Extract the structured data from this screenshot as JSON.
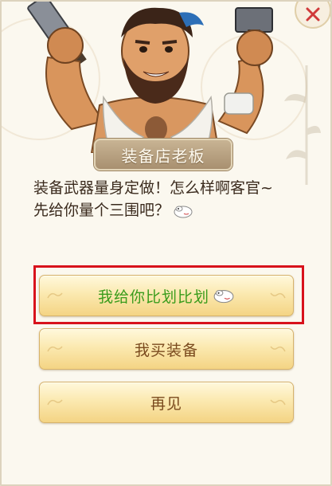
{
  "npc": {
    "name": "装备店老板",
    "portrait_icon": "blacksmith-npc-portrait"
  },
  "dialogue": {
    "line1": "装备武器量身定做！怎么样啊客官~",
    "line2": "先给你量个三围吧？",
    "emoji": "sheep-emoji-icon"
  },
  "options": [
    {
      "label": "我给你比划比划",
      "emoji": "sheep-emoji-icon",
      "selected": true
    },
    {
      "label": "我买装备"
    },
    {
      "label": "再见"
    }
  ],
  "colors": {
    "highlight_border": "#d8121c",
    "selected_option_text": "#3a9c1c",
    "option_text": "#7a4a1e",
    "dialogue_text": "#3a2a1d"
  }
}
